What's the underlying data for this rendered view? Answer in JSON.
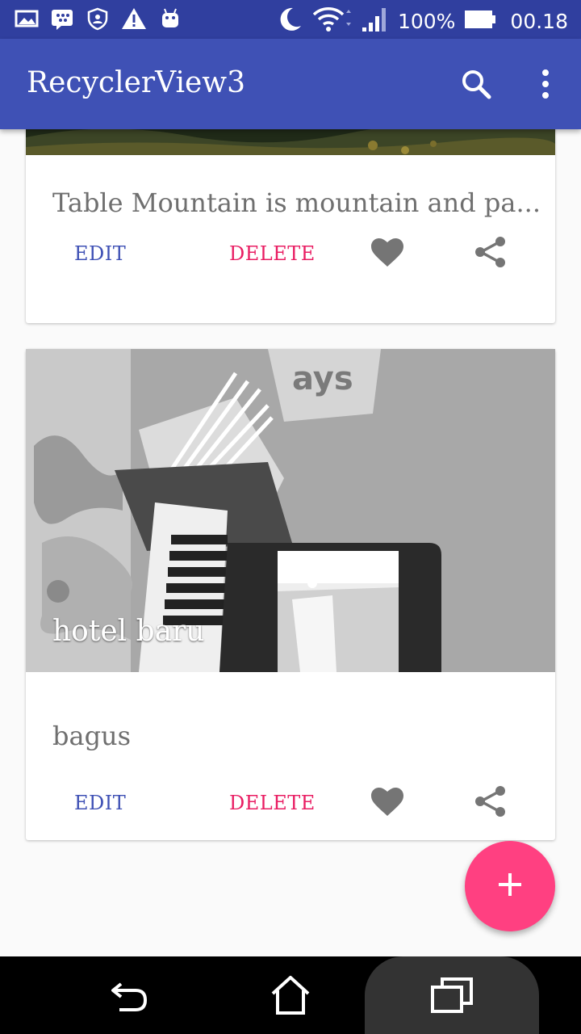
{
  "status_bar": {
    "battery_percent_label": "100%",
    "time": "00.18",
    "icons": [
      "gallery-icon",
      "bbm-icon",
      "shield-user-icon",
      "warning-icon",
      "android-icon",
      "moon-icon",
      "wifi-icon",
      "signal-icon",
      "battery-icon"
    ]
  },
  "app_bar": {
    "title": "RecyclerView3",
    "icons": [
      "search-icon",
      "more-vert-icon"
    ]
  },
  "cards": [
    {
      "title": "",
      "description": "Table Mountain is mountain and pa...",
      "edit_label": "EDIT",
      "delete_label": "DELETE"
    },
    {
      "title": "hotel baru",
      "description": "bagus",
      "edit_label": "EDIT",
      "delete_label": "DELETE"
    }
  ],
  "fab": {
    "icon": "add-icon"
  },
  "nav_bar": {
    "icons": [
      "back-icon",
      "home-icon",
      "recents-icon"
    ]
  },
  "colors": {
    "status_bar": "#303f9f",
    "app_bar": "#3f51b5",
    "edit": "#3f51b5",
    "delete": "#e91e63",
    "fab": "#ff4081"
  }
}
